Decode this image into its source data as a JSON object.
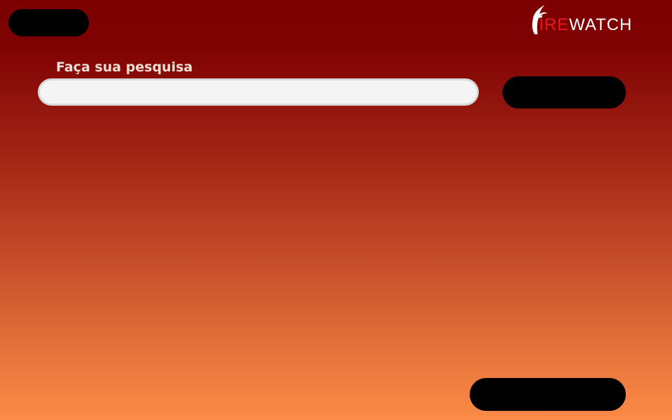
{
  "header": {
    "logo": {
      "text_highlight": "IRE",
      "text_rest": "WATCH",
      "highlight_color": "#e31b1b",
      "rest_color": "#ffffff",
      "icon": "flame-f-icon"
    }
  },
  "search": {
    "label": "Faça sua pesquisa",
    "value": "",
    "placeholder": ""
  },
  "colors": {
    "gradient_top": "#7d0000",
    "gradient_bottom": "#fb8b47",
    "button": "#000000",
    "input_bg": "#f4f4f4"
  }
}
